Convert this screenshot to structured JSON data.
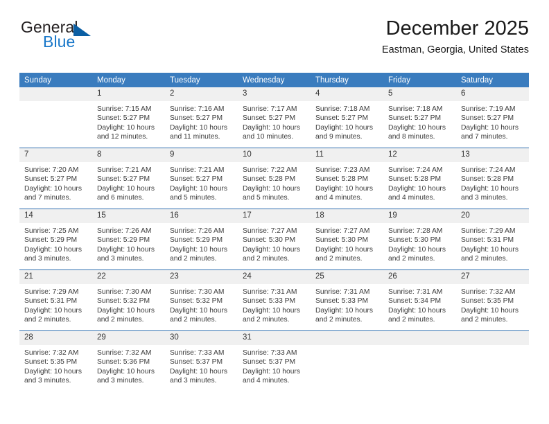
{
  "brand": {
    "name_top": "General",
    "name_bottom": "Blue",
    "triangle_icon": "triangle-icon",
    "accent_color": "#1877c9",
    "triangle_color": "#0b5fa4"
  },
  "header": {
    "title": "December 2025",
    "subtitle": "Eastman, Georgia, United States"
  },
  "theme": {
    "header_row_bg": "#3a7cbe",
    "header_row_text": "#ffffff",
    "daynum_bg": "#f0f0f0",
    "row_border": "#2f6fb0"
  },
  "calendar": {
    "weekday_headers": [
      "Sunday",
      "Monday",
      "Tuesday",
      "Wednesday",
      "Thursday",
      "Friday",
      "Saturday"
    ],
    "weeks": [
      [
        {
          "day": "",
          "sunrise": "",
          "sunset": "",
          "daylight": "",
          "empty": true
        },
        {
          "day": "1",
          "sunrise": "Sunrise: 7:15 AM",
          "sunset": "Sunset: 5:27 PM",
          "daylight": "Daylight: 10 hours and 12 minutes."
        },
        {
          "day": "2",
          "sunrise": "Sunrise: 7:16 AM",
          "sunset": "Sunset: 5:27 PM",
          "daylight": "Daylight: 10 hours and 11 minutes."
        },
        {
          "day": "3",
          "sunrise": "Sunrise: 7:17 AM",
          "sunset": "Sunset: 5:27 PM",
          "daylight": "Daylight: 10 hours and 10 minutes."
        },
        {
          "day": "4",
          "sunrise": "Sunrise: 7:18 AM",
          "sunset": "Sunset: 5:27 PM",
          "daylight": "Daylight: 10 hours and 9 minutes."
        },
        {
          "day": "5",
          "sunrise": "Sunrise: 7:18 AM",
          "sunset": "Sunset: 5:27 PM",
          "daylight": "Daylight: 10 hours and 8 minutes."
        },
        {
          "day": "6",
          "sunrise": "Sunrise: 7:19 AM",
          "sunset": "Sunset: 5:27 PM",
          "daylight": "Daylight: 10 hours and 7 minutes."
        }
      ],
      [
        {
          "day": "7",
          "sunrise": "Sunrise: 7:20 AM",
          "sunset": "Sunset: 5:27 PM",
          "daylight": "Daylight: 10 hours and 7 minutes."
        },
        {
          "day": "8",
          "sunrise": "Sunrise: 7:21 AM",
          "sunset": "Sunset: 5:27 PM",
          "daylight": "Daylight: 10 hours and 6 minutes."
        },
        {
          "day": "9",
          "sunrise": "Sunrise: 7:21 AM",
          "sunset": "Sunset: 5:27 PM",
          "daylight": "Daylight: 10 hours and 5 minutes."
        },
        {
          "day": "10",
          "sunrise": "Sunrise: 7:22 AM",
          "sunset": "Sunset: 5:28 PM",
          "daylight": "Daylight: 10 hours and 5 minutes."
        },
        {
          "day": "11",
          "sunrise": "Sunrise: 7:23 AM",
          "sunset": "Sunset: 5:28 PM",
          "daylight": "Daylight: 10 hours and 4 minutes."
        },
        {
          "day": "12",
          "sunrise": "Sunrise: 7:24 AM",
          "sunset": "Sunset: 5:28 PM",
          "daylight": "Daylight: 10 hours and 4 minutes."
        },
        {
          "day": "13",
          "sunrise": "Sunrise: 7:24 AM",
          "sunset": "Sunset: 5:28 PM",
          "daylight": "Daylight: 10 hours and 3 minutes."
        }
      ],
      [
        {
          "day": "14",
          "sunrise": "Sunrise: 7:25 AM",
          "sunset": "Sunset: 5:29 PM",
          "daylight": "Daylight: 10 hours and 3 minutes."
        },
        {
          "day": "15",
          "sunrise": "Sunrise: 7:26 AM",
          "sunset": "Sunset: 5:29 PM",
          "daylight": "Daylight: 10 hours and 3 minutes."
        },
        {
          "day": "16",
          "sunrise": "Sunrise: 7:26 AM",
          "sunset": "Sunset: 5:29 PM",
          "daylight": "Daylight: 10 hours and 2 minutes."
        },
        {
          "day": "17",
          "sunrise": "Sunrise: 7:27 AM",
          "sunset": "Sunset: 5:30 PM",
          "daylight": "Daylight: 10 hours and 2 minutes."
        },
        {
          "day": "18",
          "sunrise": "Sunrise: 7:27 AM",
          "sunset": "Sunset: 5:30 PM",
          "daylight": "Daylight: 10 hours and 2 minutes."
        },
        {
          "day": "19",
          "sunrise": "Sunrise: 7:28 AM",
          "sunset": "Sunset: 5:30 PM",
          "daylight": "Daylight: 10 hours and 2 minutes."
        },
        {
          "day": "20",
          "sunrise": "Sunrise: 7:29 AM",
          "sunset": "Sunset: 5:31 PM",
          "daylight": "Daylight: 10 hours and 2 minutes."
        }
      ],
      [
        {
          "day": "21",
          "sunrise": "Sunrise: 7:29 AM",
          "sunset": "Sunset: 5:31 PM",
          "daylight": "Daylight: 10 hours and 2 minutes."
        },
        {
          "day": "22",
          "sunrise": "Sunrise: 7:30 AM",
          "sunset": "Sunset: 5:32 PM",
          "daylight": "Daylight: 10 hours and 2 minutes."
        },
        {
          "day": "23",
          "sunrise": "Sunrise: 7:30 AM",
          "sunset": "Sunset: 5:32 PM",
          "daylight": "Daylight: 10 hours and 2 minutes."
        },
        {
          "day": "24",
          "sunrise": "Sunrise: 7:31 AM",
          "sunset": "Sunset: 5:33 PM",
          "daylight": "Daylight: 10 hours and 2 minutes."
        },
        {
          "day": "25",
          "sunrise": "Sunrise: 7:31 AM",
          "sunset": "Sunset: 5:33 PM",
          "daylight": "Daylight: 10 hours and 2 minutes."
        },
        {
          "day": "26",
          "sunrise": "Sunrise: 7:31 AM",
          "sunset": "Sunset: 5:34 PM",
          "daylight": "Daylight: 10 hours and 2 minutes."
        },
        {
          "day": "27",
          "sunrise": "Sunrise: 7:32 AM",
          "sunset": "Sunset: 5:35 PM",
          "daylight": "Daylight: 10 hours and 2 minutes."
        }
      ],
      [
        {
          "day": "28",
          "sunrise": "Sunrise: 7:32 AM",
          "sunset": "Sunset: 5:35 PM",
          "daylight": "Daylight: 10 hours and 3 minutes."
        },
        {
          "day": "29",
          "sunrise": "Sunrise: 7:32 AM",
          "sunset": "Sunset: 5:36 PM",
          "daylight": "Daylight: 10 hours and 3 minutes."
        },
        {
          "day": "30",
          "sunrise": "Sunrise: 7:33 AM",
          "sunset": "Sunset: 5:37 PM",
          "daylight": "Daylight: 10 hours and 3 minutes."
        },
        {
          "day": "31",
          "sunrise": "Sunrise: 7:33 AM",
          "sunset": "Sunset: 5:37 PM",
          "daylight": "Daylight: 10 hours and 4 minutes."
        },
        {
          "day": "",
          "sunrise": "",
          "sunset": "",
          "daylight": "",
          "empty": true
        },
        {
          "day": "",
          "sunrise": "",
          "sunset": "",
          "daylight": "",
          "empty": true
        },
        {
          "day": "",
          "sunrise": "",
          "sunset": "",
          "daylight": "",
          "empty": true
        }
      ]
    ]
  }
}
